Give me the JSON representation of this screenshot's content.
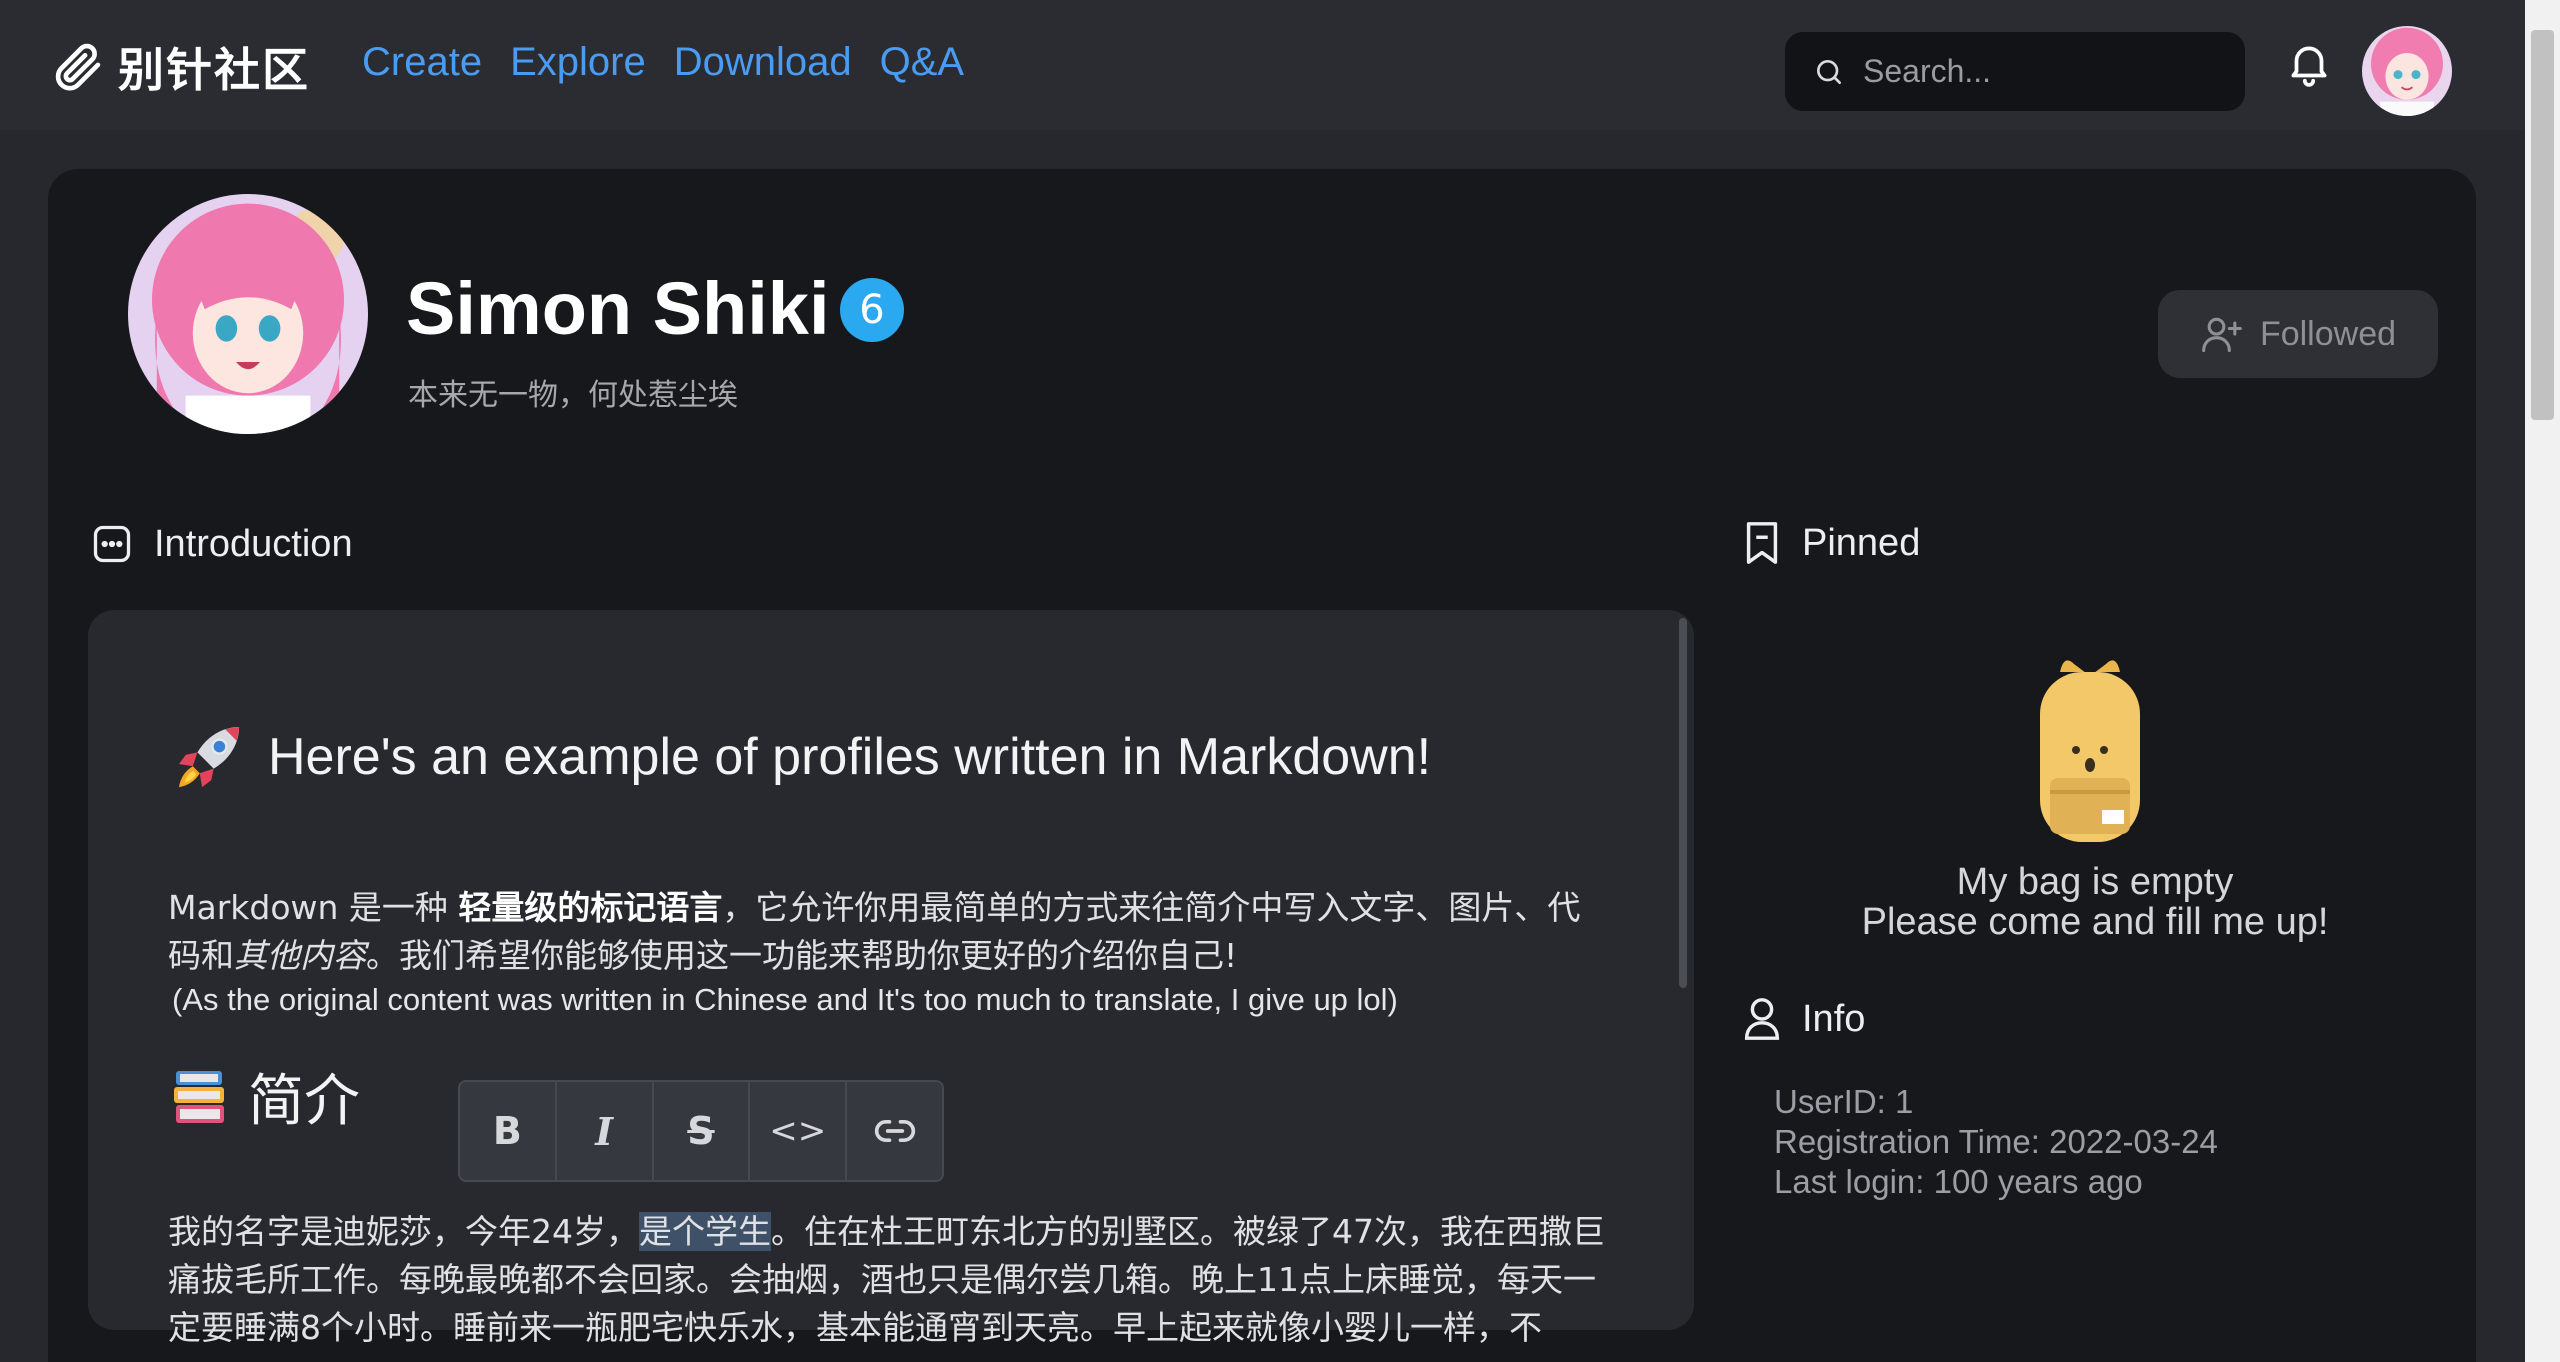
{
  "nav": {
    "logo_text": "别针社区",
    "links": [
      "Create",
      "Explore",
      "Download",
      "Q&A"
    ],
    "search_placeholder": "Search..."
  },
  "profile": {
    "name": "Simon Shiki",
    "level": "6",
    "signature": "本来无一物，何处惹尘埃",
    "follow_label": "Followed"
  },
  "introduction": {
    "title": "Introduction",
    "heading": "Here's an example of profiles written in Markdown!",
    "p1_a": "Markdown 是一种 ",
    "p1_bold": "轻量级的标记语言",
    "p1_b": "，它允许你用最简单的方式来往简介中写入文字、图片、代码和",
    "p1_italic": "其他内容",
    "p1_c": "。我们希望你能够使用这一功能来帮助你更好的介绍你自己!",
    "note": "(As the original content was written in Chinese and It's too much to translate, I give up lol)",
    "h2": "简介",
    "p2_a": "我的名字是迪妮莎，今年24岁，",
    "p2_highlight": "是个学生",
    "p2_b": "。住在杜王町东北方的别墅区。被绿了47次，我在西撒巨痛拔毛所工作。每晚最晚都不会回家。会抽烟，酒也只是偶尔尝几箱。晚上11点上床睡觉，每天一定要睡满8个小时。睡前来一瓶肥宅快乐水，基本能通宵到天亮。早上起来就像小婴儿一样，不"
  },
  "toolbar": [
    "B",
    "I",
    "S",
    "<>",
    "link"
  ],
  "pinned": {
    "title": "Pinned",
    "empty_line1": "My bag is empty",
    "empty_line2": "Please come and fill me up!"
  },
  "info": {
    "title": "Info",
    "user_id": "UserID: 1",
    "registration": "Registration Time: 2022-03-24",
    "last_login": "Last login: 100 years ago"
  },
  "icons": [
    "paperclip-icon",
    "search-icon",
    "bell-icon",
    "user-plus-icon",
    "chat-icon",
    "bookmark-icon",
    "rocket-icon",
    "books-icon",
    "backpack-icon",
    "user-icon"
  ],
  "colors": {
    "accent": "#4a9bf2",
    "badge": "#2aa8f0",
    "panel": "#17181b",
    "card": "#27292e"
  }
}
